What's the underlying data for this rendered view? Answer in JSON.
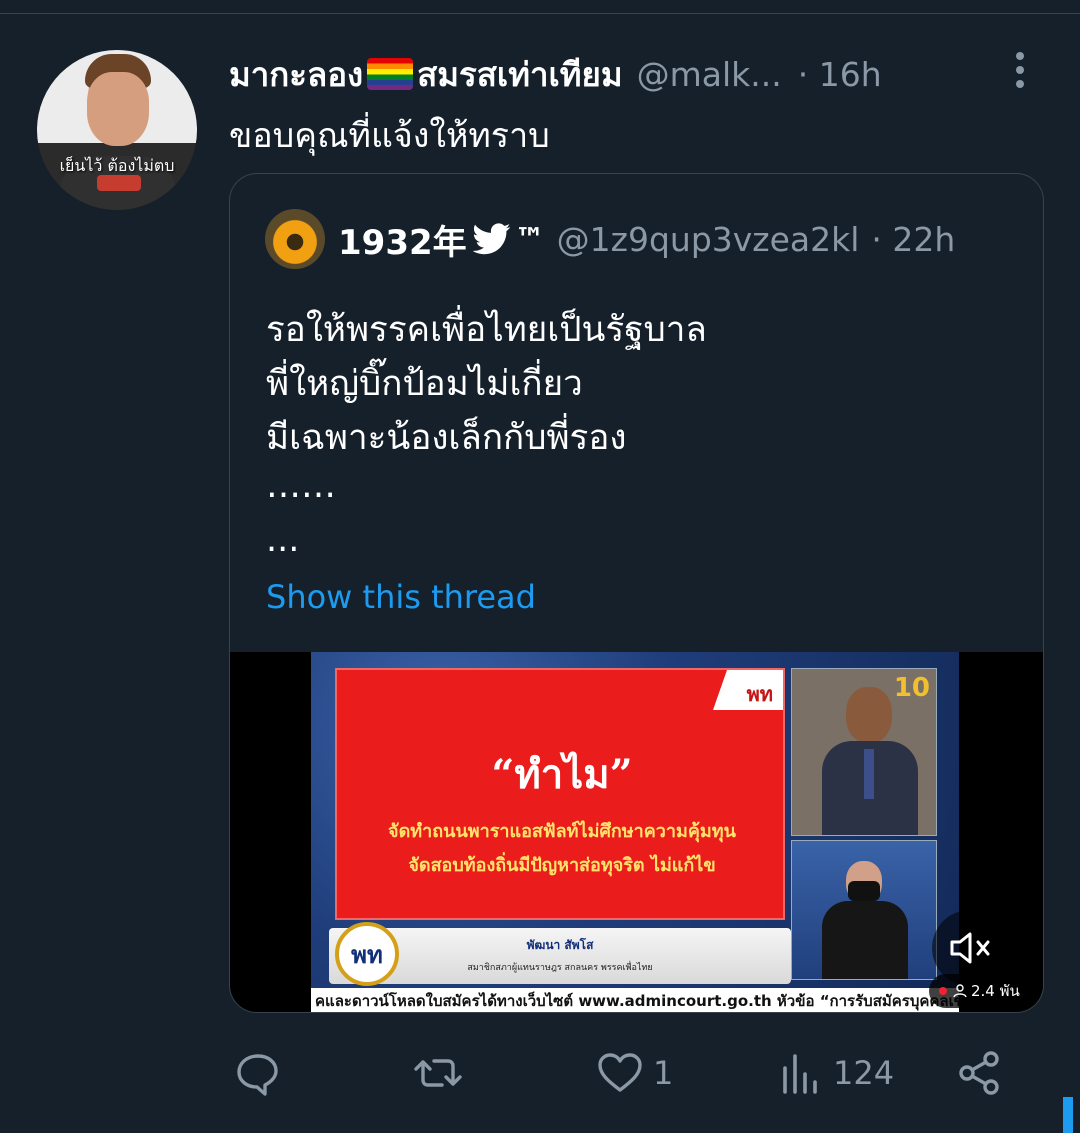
{
  "tweet": {
    "display_name_part1": "มากะลอง",
    "display_name_part2": "สมรสเท่าเทียม",
    "flag_icon": "rainbow-flag-icon",
    "handle": "@malk...",
    "time": "· 16h",
    "text": "ขอบคุณที่แจ้งให้ทราบ",
    "avatar_caption": "เย็นไว้ ต้องไม่ตบ"
  },
  "quoted": {
    "name": "1932年",
    "tm": "™",
    "handle": "@1z9qup3vzea2kl",
    "time": "· 22h",
    "lines": [
      "รอให้พรรคเพื่อไทยเป็นรัฐบาล",
      "พี่ใหญ่บิ๊กป้อมไม่เกี่ยว",
      "มีเฉพาะน้องเล็กกับพี่รอง",
      "……",
      "..."
    ],
    "show_thread": "Show this thread",
    "media": {
      "tab_label": "พท",
      "title": "“ทำไม”",
      "line1": "จัดทำถนนพาราแอสฟัลท์ไม่ศึกษาความคุ้มทุน",
      "line2": "จัดสอบท้องถิ่นมีปัญหาส่อทุจริต ไม่แก้ไข",
      "logo": "พท",
      "speaker_name": "พัฒนา สัพโส",
      "speaker_role": "สมาชิกสภาผู้แทนราษฎร สกลนคร พรรคเพื่อไทย",
      "channel": "10",
      "ticker": "คและดาวน์โหลดใบสมัครได้ทางเว็บไซต์ www.admincourt.go.th หัวข้อ “การรับสมัครบุคคลเข้ารับก",
      "viewers": "2.4 พัน"
    }
  },
  "actions": {
    "reply_count": "",
    "retweet_count": "",
    "like_count": "1",
    "views_count": "124"
  },
  "colors": {
    "background": "#15202b",
    "secondary_text": "#8b98a5",
    "accent": "#1d9bf0",
    "border": "#38444d"
  }
}
